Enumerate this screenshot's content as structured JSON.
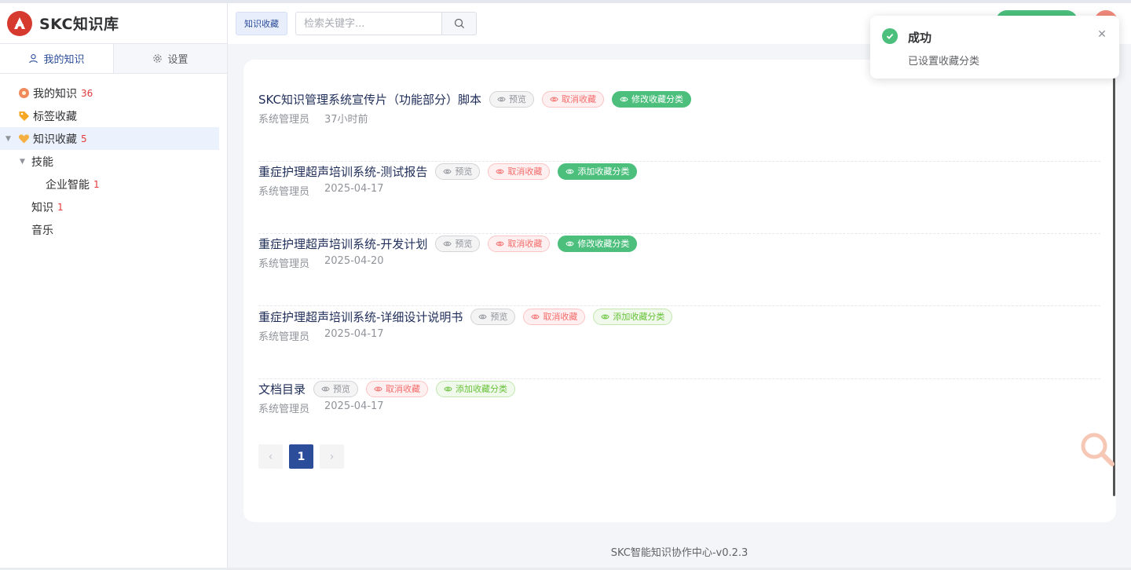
{
  "app": {
    "title": "SKC知识库"
  },
  "side_tabs": {
    "mine": "我的知识",
    "settings": "设置"
  },
  "tree": {
    "my_knowledge": {
      "label": "我的知识",
      "count": "36"
    },
    "tag_fav": {
      "label": "标签收藏"
    },
    "knowledge_fav": {
      "label": "知识收藏",
      "count": "5"
    },
    "skills": {
      "label": "技能"
    },
    "enterprise_ai": {
      "label": "企业智能",
      "count": "1"
    },
    "knowledge": {
      "label": "知识",
      "count": "1"
    },
    "music": {
      "label": "音乐"
    }
  },
  "topbar": {
    "chip": "知识收藏",
    "search_placeholder": "检索关键字..."
  },
  "buttons": {
    "preview": "预览",
    "cancel_fav": "取消收藏",
    "edit_category": "修改收藏分类",
    "add_category": "添加收藏分类"
  },
  "items": [
    {
      "title": "SKC知识管理系统宣传片（功能部分）脚本",
      "author": "系统管理员",
      "time": "37小时前",
      "action": "修改收藏分类"
    },
    {
      "title": "重症护理超声培训系统-测试报告",
      "author": "系统管理员",
      "time": "2025-04-17",
      "action": "添加收藏分类"
    },
    {
      "title": "重症护理超声培训系统-开发计划",
      "author": "系统管理员",
      "time": "2025-04-20",
      "action": "修改收藏分类"
    },
    {
      "title": "重症护理超声培训系统-详细设计说明书",
      "author": "系统管理员",
      "time": "2025-04-17",
      "action": "添加收藏分类"
    },
    {
      "title": "文档目录",
      "author": "系统管理员",
      "time": "2025-04-17",
      "action": "添加收藏分类"
    }
  ],
  "pagination": {
    "prev": "‹",
    "current": "1",
    "next": "›"
  },
  "footer": "SKC智能知识协作中心-v0.2.3",
  "toast": {
    "title": "成功",
    "message": "已设置收藏分类"
  },
  "colors": {
    "primary": "#2b4d9a",
    "success": "#4cbf7d",
    "danger": "#f56c6c",
    "brand": "#d63a2f"
  }
}
